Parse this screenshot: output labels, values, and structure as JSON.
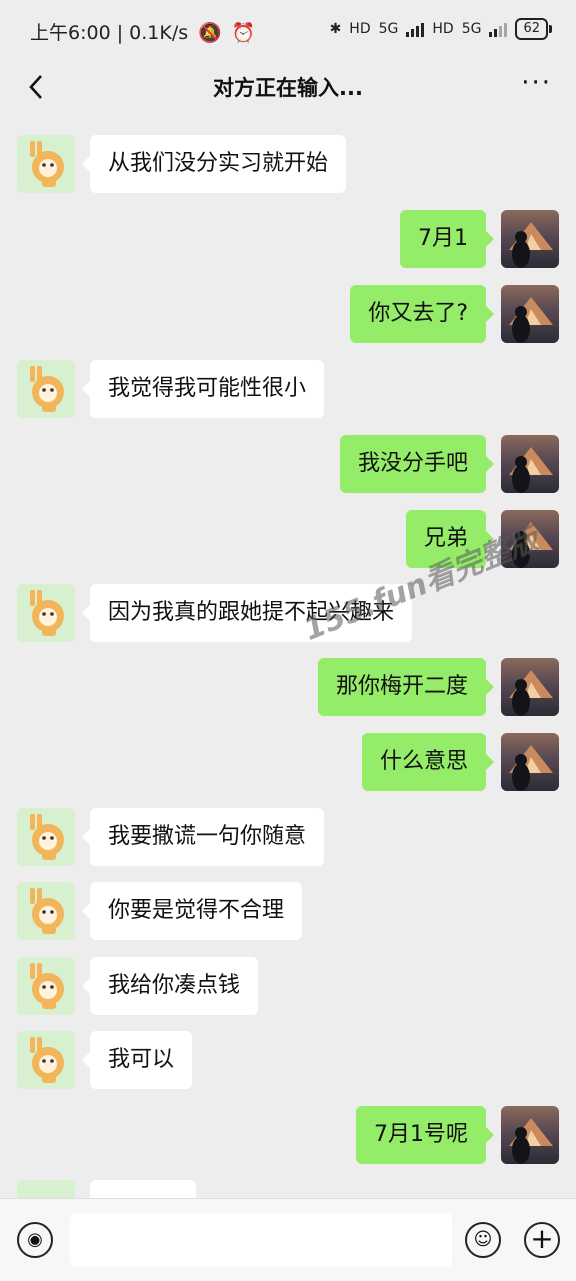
{
  "status_bar": {
    "time": "上午6:00",
    "speed": "0.1K/s",
    "network_1": "5G",
    "network_2": "5G",
    "hd": "HD",
    "battery": "62"
  },
  "header": {
    "title": "对方正在输入..."
  },
  "messages": [
    {
      "side": "left",
      "text": "从我们没分实习就开始"
    },
    {
      "side": "right",
      "text": "7月1"
    },
    {
      "side": "right",
      "text": "你又去了?"
    },
    {
      "side": "left",
      "text": "我觉得我可能性很小"
    },
    {
      "side": "right",
      "text": "我没分手吧"
    },
    {
      "side": "right",
      "text": "兄弟"
    },
    {
      "side": "left",
      "text": "因为我真的跟她提不起兴趣来"
    },
    {
      "side": "right",
      "text": "那你梅开二度"
    },
    {
      "side": "right",
      "text": "什么意思"
    },
    {
      "side": "left",
      "text": "我要撒谎一句你随意"
    },
    {
      "side": "left",
      "text": "你要是觉得不合理"
    },
    {
      "side": "left",
      "text": "我给你凑点钱"
    },
    {
      "side": "left",
      "text": "我可以"
    },
    {
      "side": "right",
      "text": "7月1号呢"
    }
  ],
  "watermark": "155.fun看完整版",
  "input": {
    "placeholder": ""
  },
  "colors": {
    "background": "#ededed",
    "sent_bubble": "#95ec69",
    "received_bubble": "#ffffff"
  },
  "icons": [
    "back-icon",
    "more-icon",
    "voice-icon",
    "emoji-icon",
    "plus-icon"
  ]
}
